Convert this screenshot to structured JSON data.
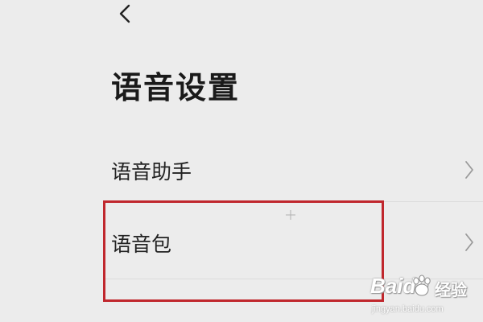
{
  "page": {
    "title": "语音设置"
  },
  "menu": {
    "items": [
      {
        "label": "语音助手"
      },
      {
        "label": "语音包"
      }
    ]
  },
  "icons": {
    "back": "back-arrow-icon",
    "chevron": "chevron-right-icon"
  },
  "highlight": {
    "color": "#c0272d"
  },
  "watermark": {
    "brand": "Baidu",
    "brand_cn": "经验",
    "url": "jingyan.baidu.com"
  }
}
